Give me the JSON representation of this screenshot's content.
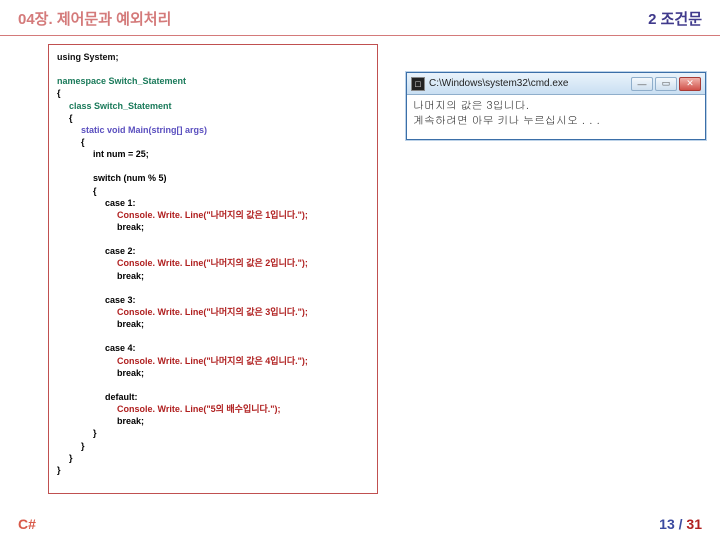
{
  "header": {
    "left": "04장. 제어문과 예외처리",
    "right": "2 조건문"
  },
  "code": {
    "using": "using System;",
    "ns": "namespace Switch_Statement",
    "openBrace": "{",
    "cls": "class Switch_Statement",
    "method": "static void Main(string[] args)",
    "numDecl": "int    num = 25;",
    "switch": "switch (num   %   5)",
    "case1": "case 1:",
    "case1w": "Console. Write. Line(\"나머지의 값은 1입니다.\");",
    "brk": "break;",
    "case2": "case 2:",
    "case2w": "Console. Write. Line(\"나머지의 값은 2입니다.\");",
    "case3": "case 3:",
    "case3w": "Console. Write. Line(\"나머지의 값은 3입니다.\");",
    "case4": "case 4:",
    "case4w": "Console. Write. Line(\"나머지의 값은 4입니다.\");",
    "default": "default:",
    "defaultw": "Console. Write. Line(\"5의 배수입니다.\");",
    "closeBrace": "}"
  },
  "console": {
    "icon": "□",
    "title": "C:\\Windows\\system32\\cmd.exe",
    "line1": "나머지의 값은 3입니다.",
    "line2": "계속하려면 아무 키나 누르십시오 . . ."
  },
  "footer": {
    "left": "C#",
    "cur": "13",
    "sep": " / ",
    "total": "31"
  }
}
